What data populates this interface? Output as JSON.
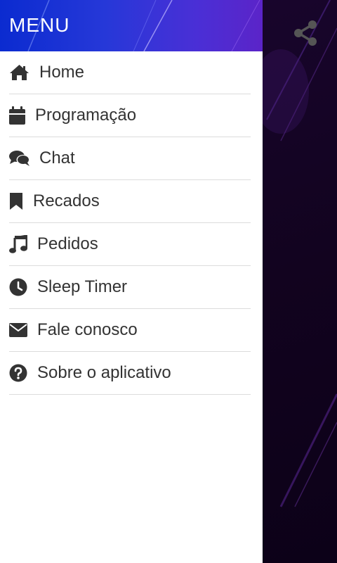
{
  "drawer": {
    "title": "MENU",
    "items": [
      {
        "label": "Home",
        "icon": "home-icon"
      },
      {
        "label": "Programação",
        "icon": "calendar-icon"
      },
      {
        "label": "Chat",
        "icon": "chat-icon"
      },
      {
        "label": "Recados",
        "icon": "bookmark-icon"
      },
      {
        "label": "Pedidos",
        "icon": "music-note-icon"
      },
      {
        "label": "Sleep Timer",
        "icon": "clock-icon"
      },
      {
        "label": "Fale conosco",
        "icon": "envelope-icon"
      },
      {
        "label": "Sobre o aplicativo",
        "icon": "question-circle-icon"
      }
    ]
  },
  "topbar": {
    "share_icon": "share-icon"
  },
  "colors": {
    "header_gradient_start": "#0b2bd0",
    "header_gradient_end": "#5b24c8",
    "background_dark": "#12031f",
    "icon_color": "#333333",
    "share_icon_color": "#555555",
    "divider": "#dcdcdc"
  }
}
